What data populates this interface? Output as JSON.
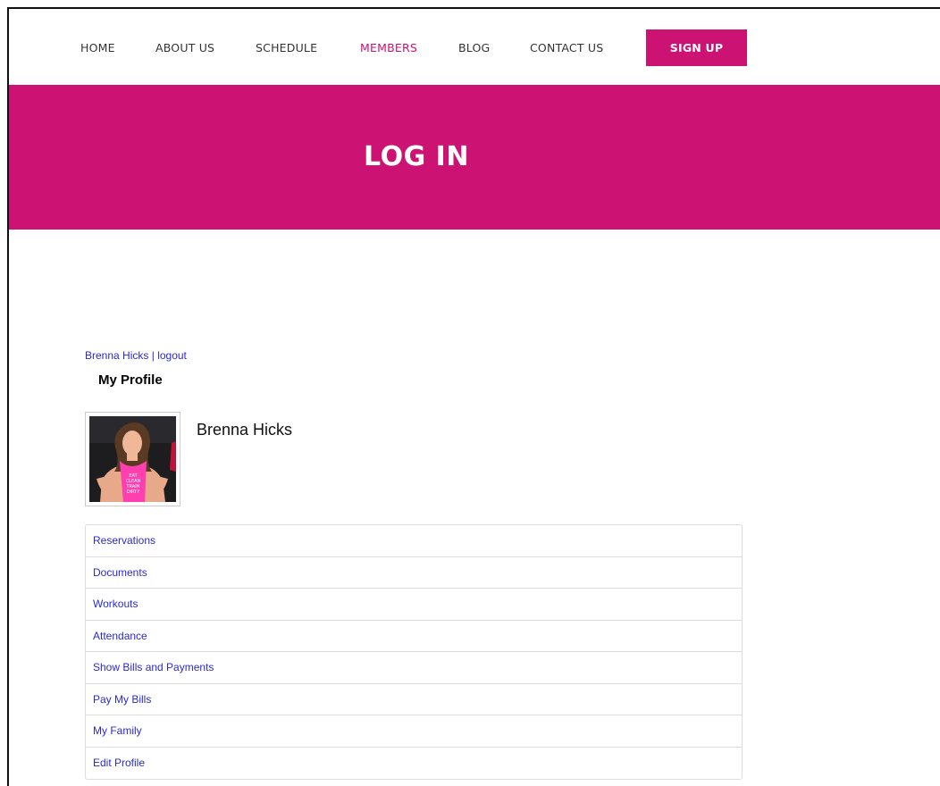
{
  "nav": {
    "items": [
      {
        "label": "HOME"
      },
      {
        "label": "ABOUT US"
      },
      {
        "label": "SCHEDULE"
      },
      {
        "label": "MEMBERS",
        "active": true
      },
      {
        "label": "BLOG"
      },
      {
        "label": "CONTACT US"
      }
    ],
    "signup_label": "SIGN UP"
  },
  "hero": {
    "title": "LOG IN"
  },
  "user": {
    "name_link": "Brenna Hicks",
    "separator": "|",
    "logout_label": "logout"
  },
  "profile": {
    "section_title": "My Profile",
    "name": "Brenna Hicks",
    "shirt_text": "EAT CLEAN TRAIN DIRTY"
  },
  "menu": {
    "items": [
      {
        "label": "Reservations"
      },
      {
        "label": "Documents"
      },
      {
        "label": "Workouts"
      },
      {
        "label": "Attendance"
      },
      {
        "label": "Show Bills and Payments"
      },
      {
        "label": "Pay My Bills"
      },
      {
        "label": "My Family"
      },
      {
        "label": "Edit Profile"
      }
    ]
  },
  "colors": {
    "brand": "#cc1273",
    "link": "#2a2ad0",
    "border": "#dddddd"
  }
}
